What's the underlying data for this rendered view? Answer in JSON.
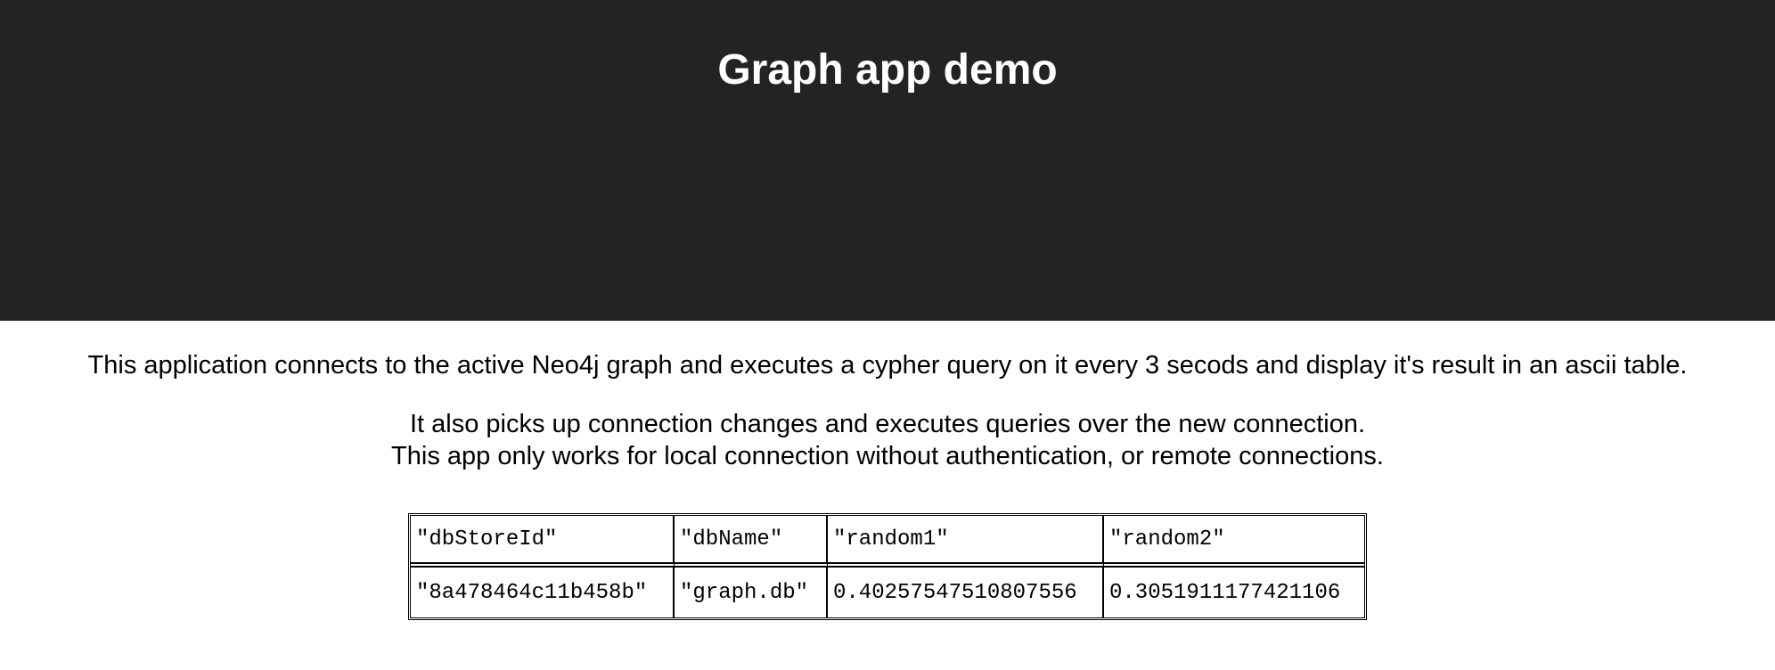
{
  "header": {
    "title": "Graph app demo"
  },
  "main": {
    "intro": "This application connects to the active Neo4j graph and executes a cypher query on it every 3 secods and display it's result in an ascii table.",
    "notes": [
      "It also picks up connection changes and executes queries over the new connection.",
      "This app only works for local connection without authentication, or remote connections."
    ]
  },
  "table": {
    "headers": [
      "\"dbStoreId\"",
      "\"dbName\"",
      "\"random1\"",
      "\"random2\""
    ],
    "rows": [
      [
        "\"8a478464c11b458b\"",
        "\"graph.db\"",
        "0.40257547510807556",
        "0.3051911177421106"
      ]
    ]
  },
  "colors": {
    "header_background": "#232323",
    "header_text": "#ffffff",
    "page_background": "#ffffff",
    "text": "#000000"
  }
}
